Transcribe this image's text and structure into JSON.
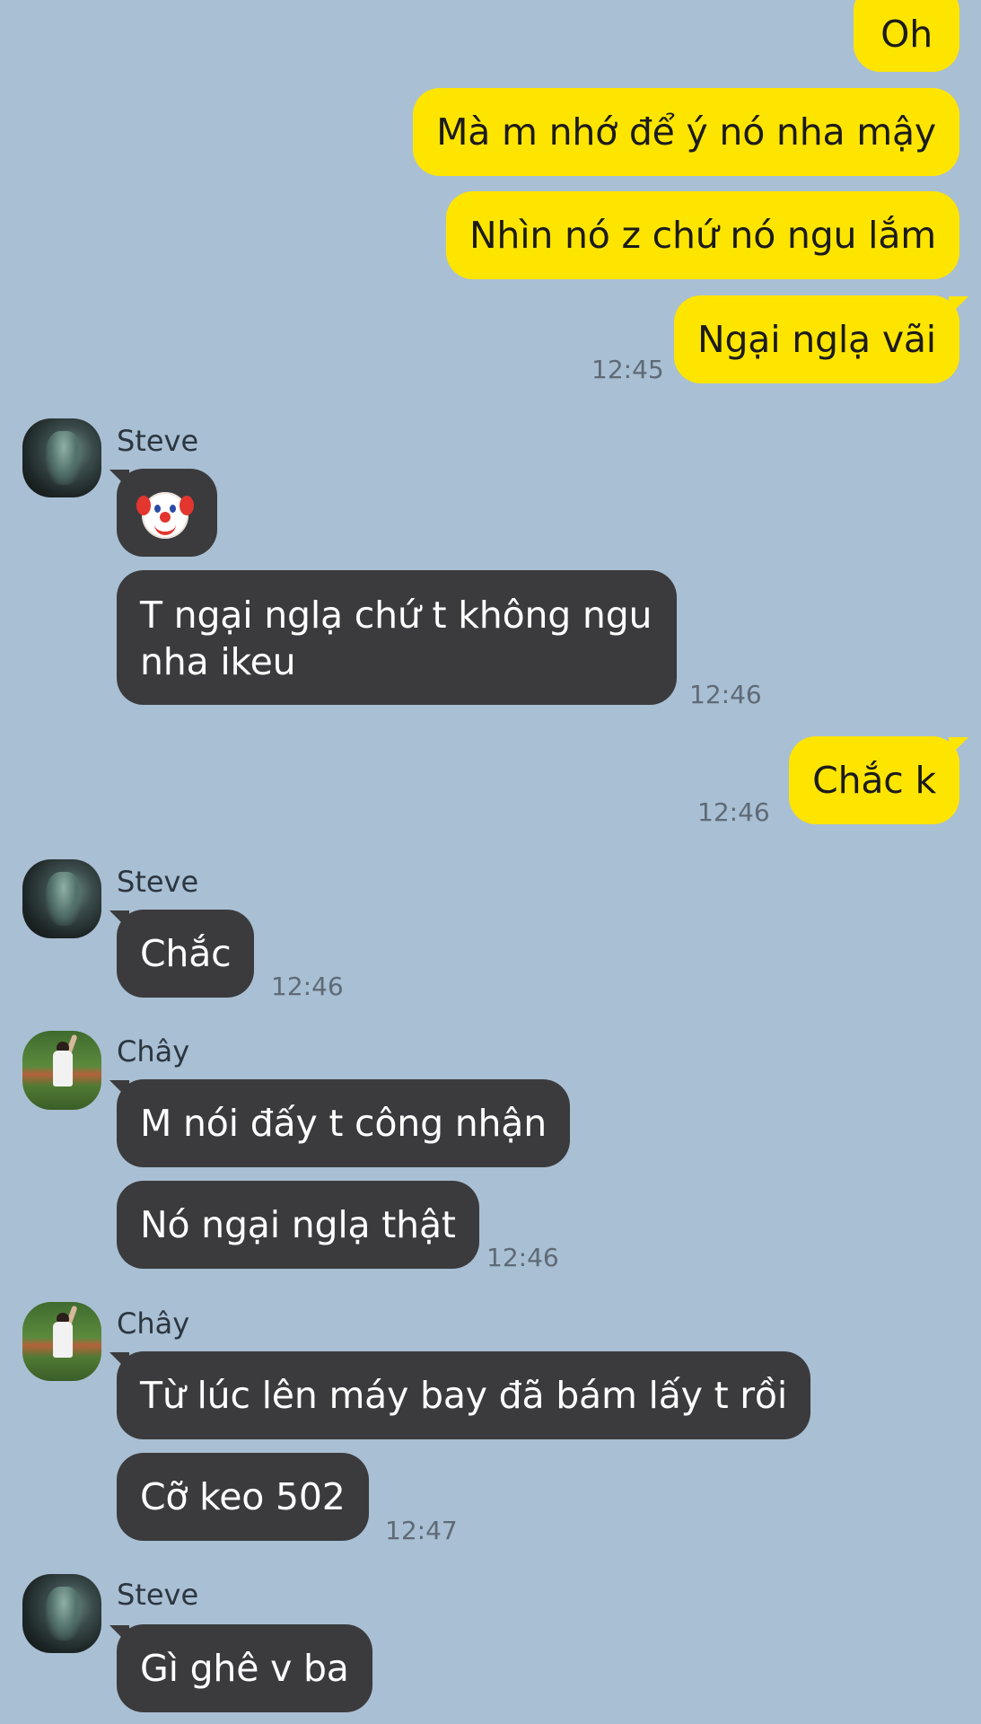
{
  "messages": {
    "m1": "Oh",
    "m2": "Mà m nhớ để ý nó nha mậy",
    "m3": "Nhìn nó z chứ nó ngu lắm",
    "m4": "Ngại nglạ vãi",
    "m5": "T ngại nglạ chứ t không ngu nha ikeu",
    "m6": "Chắc k",
    "m7": "Chắc",
    "m8": "M nói đấy t công nhận",
    "m9": "Nó ngại nglạ thật",
    "m10": "Từ lúc lên máy bay đã bám lấy t rồi",
    "m11": "Cỡ keo 502",
    "m12": "Gì ghê v ba"
  },
  "times": {
    "t1": "12:45",
    "t2": "12:46",
    "t3": "12:46",
    "t4": "12:46",
    "t5": "12:46",
    "t6": "12:47"
  },
  "senders": {
    "steve": "Steve",
    "chay": "Chây"
  },
  "emoji": {
    "clown": "clown-face"
  },
  "colors": {
    "background": "#a9bfd3",
    "outgoing_bubble": "#fee500",
    "incoming_bubble": "#3b3b3d"
  }
}
